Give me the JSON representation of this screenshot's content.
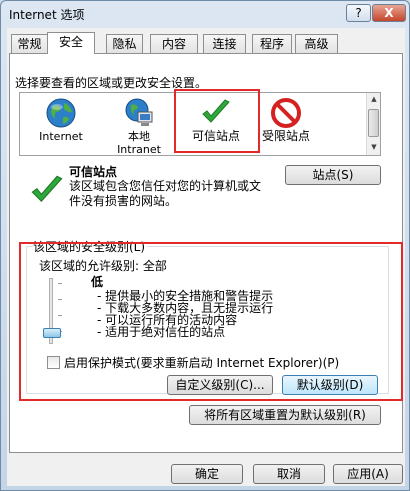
{
  "window": {
    "title": "Internet 选项",
    "help_label": "?",
    "close_label": "X"
  },
  "tabs": [
    {
      "label": "常规"
    },
    {
      "label": "安全"
    },
    {
      "label": "隐私"
    },
    {
      "label": "内容"
    },
    {
      "label": "连接"
    },
    {
      "label": "程序"
    },
    {
      "label": "高级"
    }
  ],
  "active_tab": "安全",
  "zones": {
    "instruction": "选择要查看的区域或更改安全设置。",
    "items": [
      {
        "label": "Internet",
        "icon": "globe-icon"
      },
      {
        "label": "本地\nIntranet",
        "icon": "local-intranet-icon"
      },
      {
        "label": "可信站点",
        "icon": "green-check-icon"
      },
      {
        "label": "受限站点",
        "icon": "no-entry-icon"
      }
    ],
    "selected": "可信站点"
  },
  "selected_zone": {
    "title": "可信站点",
    "description": "该区域包含您信任对您的计算机或文件没有损害的网站。",
    "sites_button": "站点(S)"
  },
  "security_level": {
    "legend": "该区域的安全级别(L)",
    "allowed_levels": "该区域的允许级别: 全部",
    "level_name": "低",
    "level_position_of_5": 1,
    "bullets": [
      "提供最小的安全措施和警告提示",
      "下载大多数内容，且无提示运行",
      "可以运行所有的活动内容",
      "适用于绝对信任的站点"
    ],
    "protected_mode_label": "启用保护模式(要求重新启动 Internet Explorer)(P)",
    "protected_mode_checked": false,
    "custom_level_button": "自定义级别(C)...",
    "default_level_button": "默认级别(D)"
  },
  "reset_all_button": "将所有区域重置为默认级别(R)",
  "footer": {
    "ok": "确定",
    "cancel": "取消",
    "apply": "应用(A)"
  },
  "colors": {
    "highlight_red": "#e22a2a",
    "check_green": "#2fa83b",
    "restricted_red": "#d42222"
  }
}
